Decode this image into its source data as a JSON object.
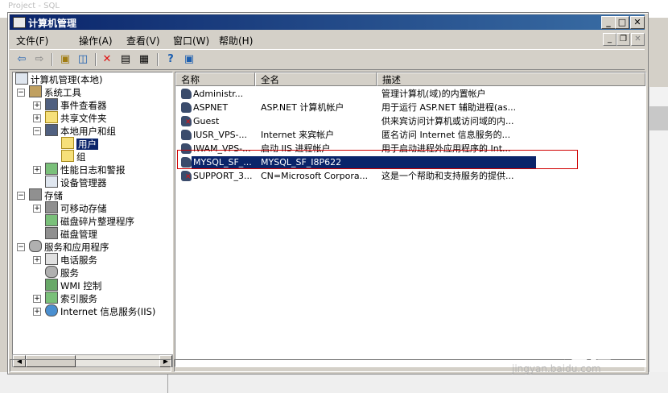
{
  "background": {
    "window_title": "Project - SQL"
  },
  "window": {
    "title": "计算机管理",
    "controls": {
      "minimize": "_",
      "maximize": "□",
      "close": "✕"
    },
    "mdi_controls": {
      "minimize": "_",
      "restore": "❐",
      "close": "✕"
    }
  },
  "menu": {
    "file": "文件(F)",
    "action": "操作(A)",
    "view": "查看(V)",
    "window": "窗口(W)",
    "help": "帮助(H)"
  },
  "toolbar": {
    "icons": [
      "back-arrow-icon",
      "forward-arrow-icon",
      "up-folder-icon",
      "show-tree-icon",
      "delete-icon",
      "properties-icon",
      "export-list-icon",
      "help-icon",
      "console-icon"
    ]
  },
  "tree": {
    "root": "计算机管理(本地)",
    "system_tools": "系统工具",
    "event_viewer": "事件查看器",
    "shared_folders": "共享文件夹",
    "local_users_groups": "本地用户和组",
    "users": "用户",
    "groups": "组",
    "perf_logs": "性能日志和警报",
    "device_manager": "设备管理器",
    "storage": "存储",
    "removable_storage": "可移动存储",
    "defrag": "磁盘碎片整理程序",
    "disk_mgmt": "磁盘管理",
    "services_apps": "服务和应用程序",
    "telephony": "电话服务",
    "services": "服务",
    "wmi": "WMI 控制",
    "indexing": "索引服务",
    "iis": "Internet 信息服务(IIS)"
  },
  "list": {
    "columns": [
      "名称",
      "全名",
      "描述"
    ],
    "rows": [
      {
        "name": "Administr...",
        "full_name": "",
        "description": "管理计算机(域)的内置帐户",
        "disabled": false
      },
      {
        "name": "ASPNET",
        "full_name": "ASP.NET 计算机帐户",
        "description": "用于运行 ASP.NET 辅助进程(as...",
        "disabled": false
      },
      {
        "name": "Guest",
        "full_name": "",
        "description": "供来宾访问计算机或访问域的内...",
        "disabled": true
      },
      {
        "name": "IUSR_VPS-...",
        "full_name": "Internet 来宾帐户",
        "description": "匿名访问 Internet 信息服务的...",
        "disabled": false
      },
      {
        "name": "IWAM_VPS-...",
        "full_name": "启动 IIS 进程帐户",
        "description": "用于启动进程外应用程序的 Int...",
        "disabled": false
      },
      {
        "name": "MYSQL_SF_...",
        "full_name": "MYSQL_SF_I8P622",
        "description": "",
        "disabled": false,
        "selected": true
      },
      {
        "name": "SUPPORT_3...",
        "full_name": "CN=Microsoft Corpora...",
        "description": "这是一个帮助和支持服务的提供...",
        "disabled": true
      }
    ]
  },
  "watermark": {
    "brand": "Bai 经验",
    "url": "jingyan.baidu.com"
  }
}
